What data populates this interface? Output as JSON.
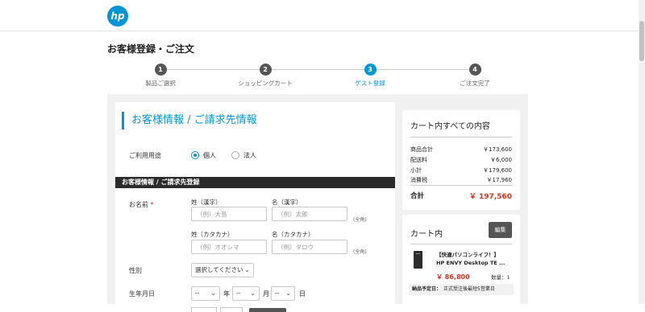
{
  "brand": {
    "logo_text": "hp",
    "color": "#0096d6"
  },
  "page_title": "お客様登録・ご注文",
  "steps": [
    {
      "num": "1",
      "label": "製品ご選択"
    },
    {
      "num": "2",
      "label": "ショッピングカート"
    },
    {
      "num": "3",
      "label": "ゲスト登録",
      "active": true
    },
    {
      "num": "4",
      "label": "ご注文完了"
    }
  ],
  "form": {
    "section_title": "お客様情報 / ご請求先情報",
    "usage_label": "ご利用用途",
    "usage_options": [
      "個人",
      "法人"
    ],
    "usage_selected": "個人",
    "sub_header": "お客様情報 / ご請求先登録",
    "name_label": "お名前",
    "required_mark": "*",
    "last_kanji_label": "姓（漢字）",
    "first_kanji_label": "名（漢字）",
    "last_kanji_placeholder": "（例）大島",
    "first_kanji_placeholder": "（例）太郎",
    "last_kana_label": "姓（カタカナ）",
    "first_kana_label": "名（カタカナ）",
    "last_kana_placeholder": "（例）オオシマ",
    "first_kana_placeholder": "（例）タロウ",
    "fullwidth_note": "(全角)",
    "gender_label": "性別",
    "gender_select": "選択してください",
    "birthday_label": "生年月日",
    "year_select": "--",
    "month_select": "--",
    "day_select": "--",
    "year_unit": "年",
    "month_unit": "月",
    "day_unit": "日"
  },
  "summary": {
    "title": "カート内すべての内容",
    "rows": [
      {
        "label": "商品合計",
        "value": "￥173,600"
      },
      {
        "label": "配送料",
        "value": "￥6,000"
      },
      {
        "label": "小計",
        "value": "￥179,600"
      },
      {
        "label": "消費税",
        "value": "￥17,960"
      }
    ],
    "total_label": "合計",
    "total_value": "￥ 197,560"
  },
  "cart": {
    "title": "カート内",
    "edit_label": "編集",
    "product_line1": "【快適パソコンライフ！】",
    "product_line2": "HP ENVY Desktop TE ...",
    "price": "￥ 86,800",
    "qty": "数量：1",
    "ship_label": "納品予定日：",
    "ship_value": "正式受注後最短5営業日"
  }
}
